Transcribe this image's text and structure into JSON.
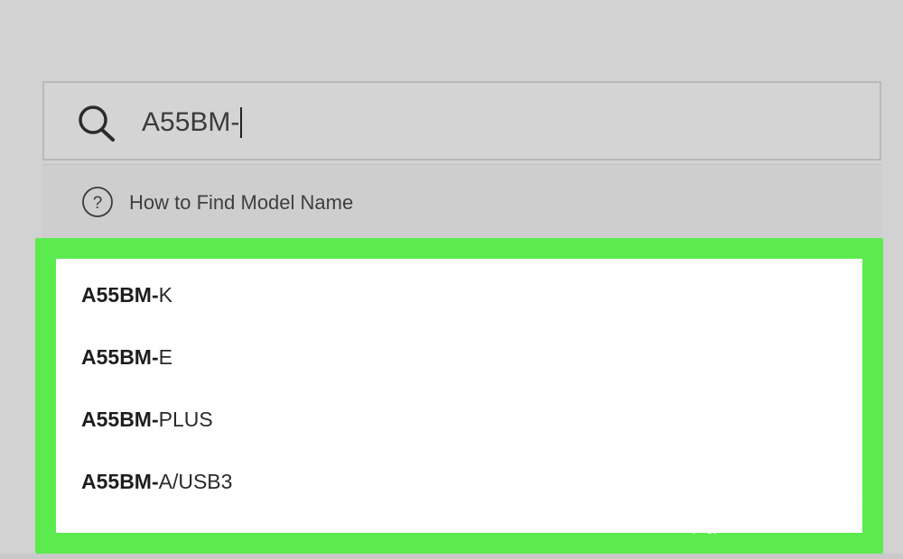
{
  "search": {
    "query": "A55BM-",
    "placeholder": ""
  },
  "help": {
    "label": "How to Find Model Name"
  },
  "results": [
    {
      "match": "A55BM-",
      "rest": "K"
    },
    {
      "match": "A55BM-",
      "rest": "E"
    },
    {
      "match": "A55BM-",
      "rest": "PLUS"
    },
    {
      "match": "A55BM-",
      "rest": "A/USB3"
    }
  ],
  "watermark": {
    "brand": "Bai du 经验",
    "url": "jingyan.baidu.com"
  },
  "colors": {
    "background": "#d2d2d2",
    "highlight_frame": "#5ceb4f",
    "panel": "#ffffff",
    "text": "#2a2a2a"
  }
}
